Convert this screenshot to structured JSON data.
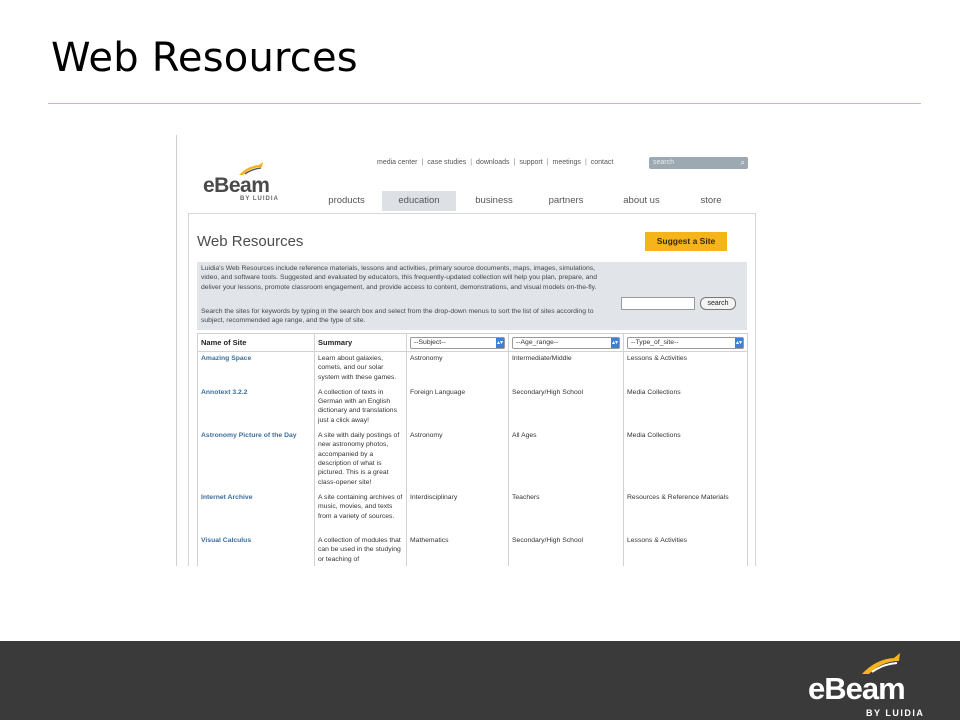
{
  "slide": {
    "title": "Web Resources"
  },
  "site": {
    "logo_text": "eBeam",
    "logo_sub": "BY LUIDIA",
    "utility_links": [
      "media center",
      "case studies",
      "downloads",
      "support",
      "meetings",
      "contact"
    ],
    "search_placeholder": "search",
    "nav_tabs": [
      {
        "label": "products"
      },
      {
        "label": "education",
        "active": true
      },
      {
        "label": "business"
      },
      {
        "label": "partners"
      },
      {
        "label": "about us"
      },
      {
        "label": "store"
      }
    ],
    "page_heading": "Web Resources",
    "suggest_button": "Suggest a Site",
    "intro_p1": "Luidia's Web Resources include reference materials, lessons and activities, primary source documents, maps, images, simulations, video, and software tools. Suggested and evaluated by educators, this frequently-updated collection will help you plan, prepare, and deliver your lessons, promote classroom engagement, and provide access to content, demonstrations, and visual models on-the-fly.",
    "intro_p2": "Search the sites for keywords by typing in the search box and select from the drop-down menus to sort the list of sites according to subject, recommended age range, and the type of site.",
    "intro_search_button": "search",
    "table": {
      "headers": {
        "name": "Name of Site",
        "summary": "Summary",
        "subject": "--Subject--",
        "age": "--Age_range--",
        "type": "--Type_of_site--"
      },
      "rows": [
        {
          "name": "Amazing Space",
          "summary": "Learn about galaxies, comets, and our solar system with these games.",
          "subject": "Astronomy",
          "age": "Intermediate/Middle",
          "type": "Lessons & Activities"
        },
        {
          "name": "Annotext 3.2.2",
          "summary": "A collection of texts in German with an English dictionary and translations just a click away!",
          "subject": "Foreign Language",
          "age": "Secondary/High School",
          "type": "Media Collections"
        },
        {
          "name": "Astronomy Picture of the Day",
          "summary": "A site with daily postings of new astronomy photos, accompanied by a description of what is pictured. This is a great class-opener site!",
          "subject": "Astronomy",
          "age": "All Ages",
          "type": "Media Collections"
        },
        {
          "name": "Internet Archive",
          "summary": "A site containing archives of music, movies, and texts from a variety of sources.",
          "subject": "Interdisciplinary",
          "age": "Teachers",
          "type": "Resources & Reference Materials"
        },
        {
          "name": "Visual Calculus",
          "summary": "A collection of modules that can be used in the studying or teaching of",
          "subject": "Mathematics",
          "age": "Secondary/High School",
          "type": "Lessons & Activities"
        }
      ]
    }
  },
  "footer": {
    "logo_text": "eBeam",
    "logo_sub": "BY LUIDIA"
  },
  "colors": {
    "accent_rule": "#d9c26a",
    "suggest_button": "#f4b41a",
    "link": "#3b6e9c",
    "footer_bg": "#3a3a3a",
    "logo_swoosh": "#f4b41a"
  }
}
